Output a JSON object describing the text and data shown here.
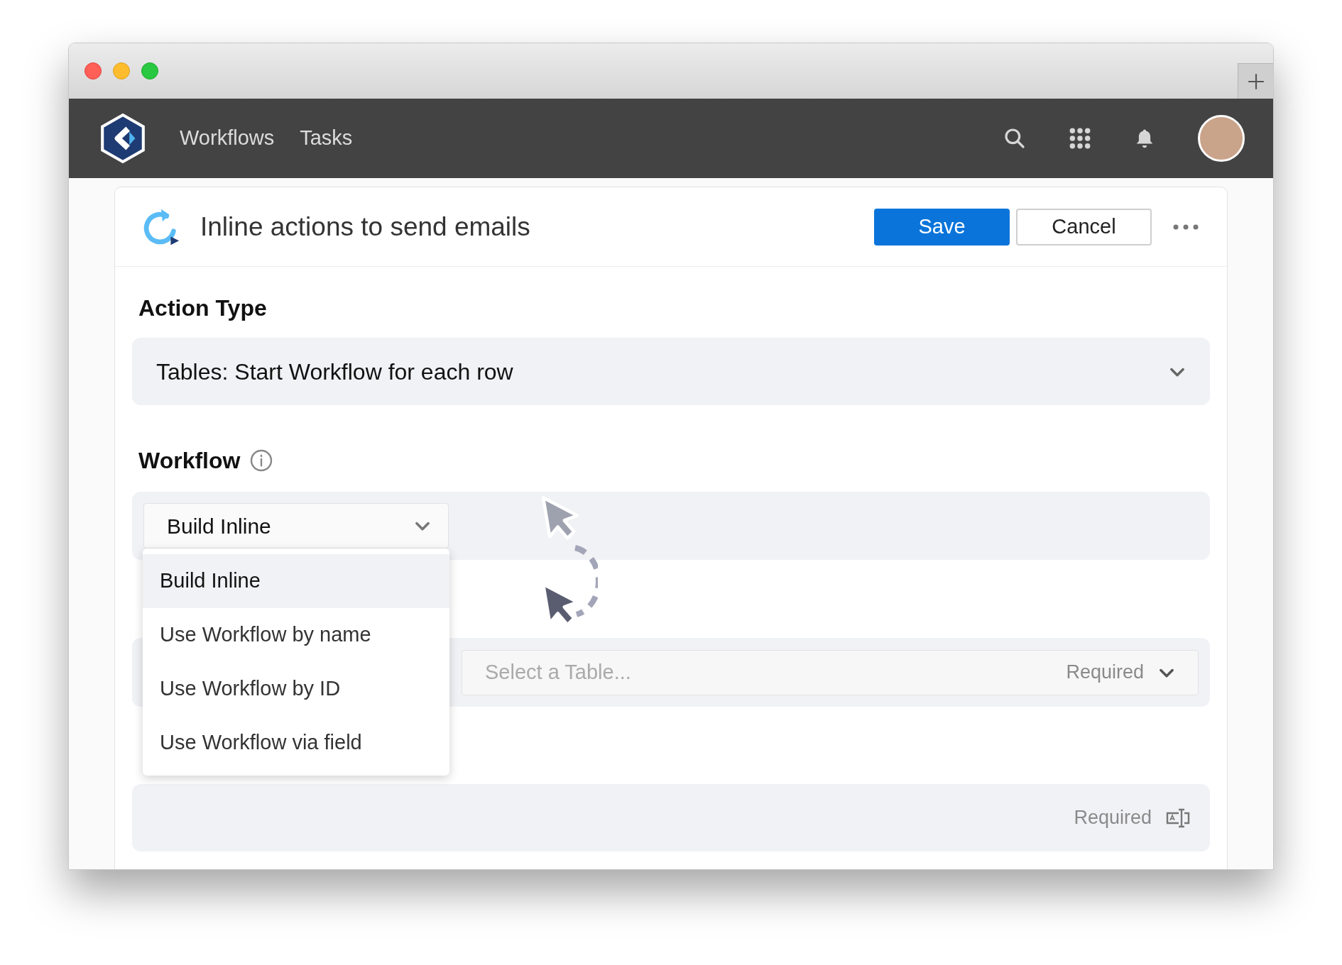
{
  "nav": {
    "items": [
      {
        "label": "Workflows"
      },
      {
        "label": "Tasks"
      }
    ]
  },
  "header": {
    "title": "Inline actions to send emails",
    "save": "Save",
    "cancel": "Cancel"
  },
  "action_type": {
    "label": "Action Type",
    "value": "Tables: Start Workflow for each row"
  },
  "workflow": {
    "label": "Workflow",
    "value": "Build Inline",
    "expanded": true,
    "options": [
      {
        "label": "Build Inline",
        "selected": true
      },
      {
        "label": "Use Workflow by name",
        "selected": false
      },
      {
        "label": "Use Workflow by ID",
        "selected": false
      },
      {
        "label": "Use Workflow via field",
        "selected": false
      }
    ]
  },
  "table_field": {
    "placeholder": "Select a Table...",
    "hint": "Required"
  },
  "bottom_field": {
    "hint": "Required"
  }
}
